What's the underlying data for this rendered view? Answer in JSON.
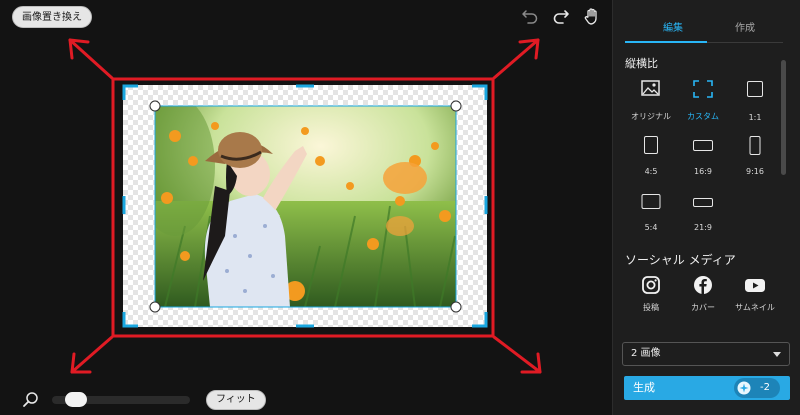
{
  "canvas": {
    "replace_button": "画像置き換え",
    "fit_button": "フィット",
    "zoom_level": 0.1,
    "toolbar_icons": [
      "undo-icon",
      "redo-icon",
      "hand-pan-icon"
    ]
  },
  "panel": {
    "tabs": [
      {
        "label": "編集",
        "active": true
      },
      {
        "label": "作成",
        "active": false
      }
    ],
    "aspect_section_title": "縦横比",
    "aspect_ratios": [
      {
        "label": "オリジナル",
        "icon": "image-icon",
        "active": false
      },
      {
        "label": "カスタム",
        "icon": "custom-crop-icon",
        "active": true
      },
      {
        "label": "1:1",
        "icon": "ratio-1-1-icon",
        "active": false
      },
      {
        "label": "4:5",
        "icon": "ratio-4-5-icon",
        "active": false
      },
      {
        "label": "16:9",
        "icon": "ratio-16-9-icon",
        "active": false
      },
      {
        "label": "9:16",
        "icon": "ratio-9-16-icon",
        "active": false
      },
      {
        "label": "5:4",
        "icon": "ratio-5-4-icon",
        "active": false
      },
      {
        "label": "21:9",
        "icon": "ratio-21-9-icon",
        "active": false
      }
    ],
    "social_section_title": "ソーシャル メディア",
    "social_items": [
      {
        "label": "投稿",
        "icon": "instagram-icon"
      },
      {
        "label": "カバー",
        "icon": "facebook-icon"
      },
      {
        "label": "サムネイル",
        "icon": "youtube-icon"
      }
    ],
    "image_count": "2 画像",
    "generate_label": "生成",
    "credit_cost": "-2"
  },
  "colors": {
    "accent": "#29b6f6",
    "generate_button": "#29a9e4",
    "annotation_red": "#e01b24",
    "selection_blue": "#1aa7e0"
  }
}
